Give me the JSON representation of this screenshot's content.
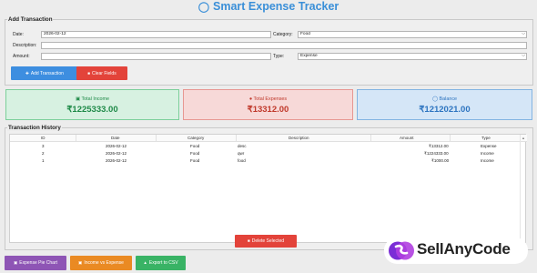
{
  "app": {
    "title": "Smart Expense Tracker",
    "title_icon": "money-bag-icon"
  },
  "add_transaction": {
    "section_title": "Add Transaction",
    "date_label": "Date:",
    "date_value": "2026-02-12",
    "category_label": "Category:",
    "category_value": "Food",
    "description_label": "Description:",
    "description_value": "",
    "amount_label": "Amount:",
    "amount_value": "",
    "type_label": "Type:",
    "type_value": "Expense",
    "add_button": "Add Transaction",
    "clear_button": "Clear Fields"
  },
  "summary": {
    "income_label": "Total Income",
    "income_value": "₹1225333.00",
    "expense_label": "Total Expenses",
    "expense_value": "₹13312.00",
    "balance_label": "Balance",
    "balance_value": "₹1212021.00"
  },
  "history": {
    "section_title": "Transaction History",
    "columns": [
      "ID",
      "Date",
      "Category",
      "Description",
      "Amount",
      "Type"
    ],
    "rows": [
      {
        "id": "3",
        "date": "2026-02-12",
        "category": "Food",
        "description": "desc",
        "amount": "₹13312.00",
        "type": "Expense"
      },
      {
        "id": "2",
        "date": "2026-02-12",
        "category": "Food",
        "description": "qwr",
        "amount": "₹1224333.00",
        "type": "Income"
      },
      {
        "id": "1",
        "date": "2026-02-12",
        "category": "Food",
        "description": "food",
        "amount": "₹1000.00",
        "type": "Income"
      }
    ],
    "delete_button": "Delete Selected"
  },
  "footer": {
    "pie_button": "Expense Pie Chart",
    "income_vs_expense_button": "Income vs Expense",
    "export_button": "Export to CSV"
  },
  "watermark": {
    "text": "SellAnyCode"
  },
  "colors": {
    "title": "#3a8fd8",
    "add_button": "#3d8ee0",
    "clear_button": "#e3433a",
    "delete_button": "#e3433a",
    "pie_button": "#8e55b5",
    "income_vs_expense_button": "#ea8a23",
    "export_button": "#39b365",
    "income": "#1f8a48",
    "expense": "#c0392b",
    "balance": "#2d74c0"
  }
}
